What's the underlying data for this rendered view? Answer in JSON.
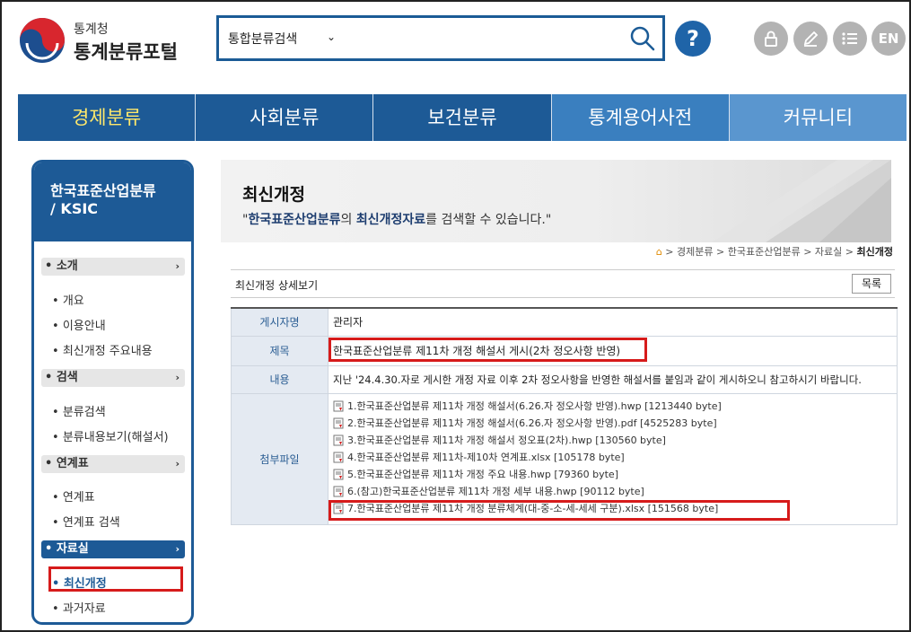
{
  "header": {
    "agency": "통계청",
    "portal_title": "통계분류포털",
    "search": {
      "scope": "통합분류검색",
      "query": ""
    },
    "help_label": "?",
    "lang_label": "EN",
    "icons": [
      "lock-icon",
      "pencil-icon",
      "list-icon"
    ]
  },
  "gnb": [
    {
      "label": "경제분류"
    },
    {
      "label": "사회분류"
    },
    {
      "label": "보건분류"
    },
    {
      "label": "통계용어사전"
    },
    {
      "label": "커뮤니티"
    }
  ],
  "sidebar": {
    "title": "한국표준산업분류",
    "subtitle": "/ KSIC",
    "sections": [
      {
        "label": "소개",
        "items": [
          "개요",
          "이용안내",
          "최신개정 주요내용"
        ]
      },
      {
        "label": "검색",
        "items": [
          "분류검색",
          "분류내용보기(해설서)"
        ]
      },
      {
        "label": "연계표",
        "items": [
          "연계표",
          "연계표 검색"
        ]
      },
      {
        "label": "자료실",
        "items": [
          "최신개정",
          "과거자료"
        ]
      }
    ]
  },
  "banner": {
    "title": "최신개정",
    "desc_q1": "\"",
    "desc_b1": "한국표준산업분류",
    "desc_m1": "의 ",
    "desc_b2": "최신개정자료",
    "desc_m2": "를 검색할 수 있습니다.\""
  },
  "breadcrumb": [
    "경제분류",
    "한국표준산업분류",
    "자료실",
    "최신개정"
  ],
  "detail": {
    "title": "최신개정 상세보기",
    "list_button": "목록",
    "rows": {
      "author_label": "게시자명",
      "author": "관리자",
      "subject_label": "제목",
      "subject": "한국표준산업분류 제11차 개정 해설서 게시(2차 정오사항 반영)",
      "content_label": "내용",
      "content": "지난 '24.4.30.자로 게시한 개정 자료 이후 2차 정오사항을 반영한 해설서를 붙임과 같이 게시하오니 참고하시기 바랍니다.",
      "files_label": "첨부파일"
    },
    "files": [
      "1.한국표준산업분류 제11차 개정 해설서(6.26.자 정오사항 반영).hwp [1213440 byte]",
      "2.한국표준산업분류 제11차 개정 해설서(6.26.자 정오사항 반영).pdf [4525283 byte]",
      "3.한국표준산업분류 제11차 개정 해설서 정오표(2차).hwp [130560 byte]",
      "4.한국표준산업분류 제11차-제10차 연계표.xlsx [105178 byte]",
      "5.한국표준산업분류 제11차 개정 주요 내용.hwp [79360 byte]",
      "6.(참고)한국표준산업분류 제11차 개정 세부 내용.hwp [90112 byte]",
      "7.한국표준산업분류 제11차 개정 분류체계(대-중-소-세-세세 구분).xlsx [151568 byte]"
    ]
  },
  "colors": {
    "brand": "#1d5a96",
    "highlight": "#d61b1b",
    "gnb_active_text": "#ffe86b"
  }
}
